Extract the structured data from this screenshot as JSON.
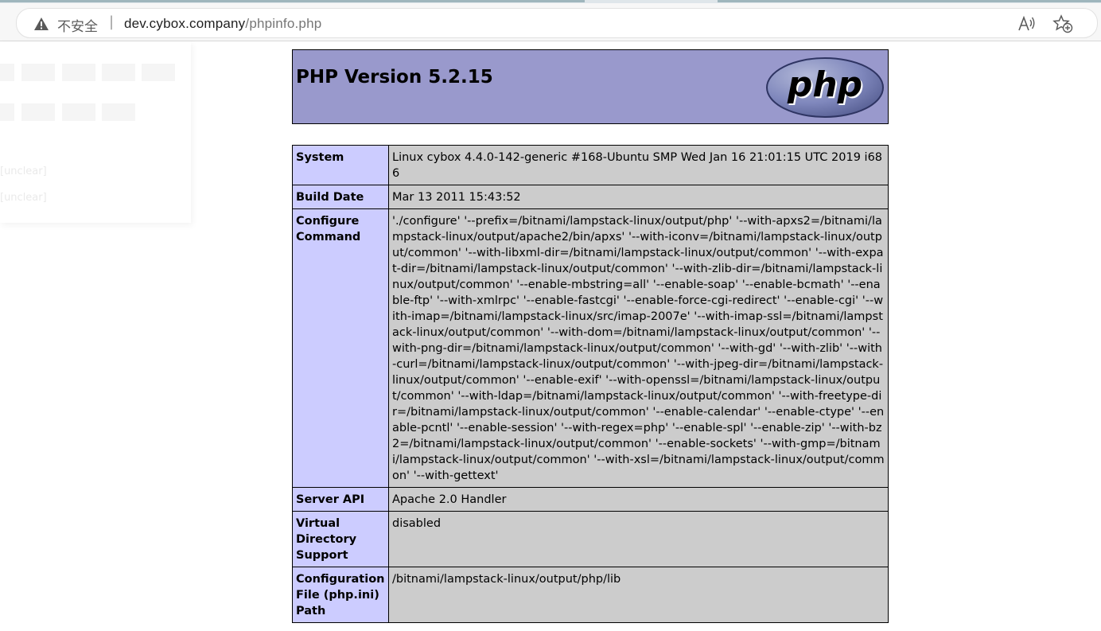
{
  "browser": {
    "security_label": "不安全",
    "url_host": "dev.cybox.company",
    "url_path": "/phpinfo.php",
    "icons": [
      "warning-icon",
      "read-aloud-icon",
      "add-favorite-icon"
    ]
  },
  "ghost_popup": {
    "line1": "[unclear]",
    "line2": "[unclear]"
  },
  "phpinfo": {
    "version_title": "PHP Version 5.2.15",
    "logo_text": "php",
    "colors": {
      "header_bg": "#9999cc",
      "key_bg": "#ccccff",
      "value_bg": "#cccccc"
    },
    "rows": [
      {
        "key": "System",
        "value": "Linux cybox 4.4.0-142-generic #168-Ubuntu SMP Wed Jan 16 21:01:15 UTC 2019 i686"
      },
      {
        "key": "Build Date",
        "value": "Mar 13 2011 15:43:52"
      },
      {
        "key": "Configure Command",
        "value": "'./configure' '--prefix=/bitnami/lampstack-linux/output/php' '--with-apxs2=/bitnami/lampstack-linux/output/apache2/bin/apxs' '--with-iconv=/bitnami/lampstack-linux/output/common' '--with-libxml-dir=/bitnami/lampstack-linux/output/common' '--with-expat-dir=/bitnami/lampstack-linux/output/common' '--with-zlib-dir=/bitnami/lampstack-linux/output/common' '--enable-mbstring=all' '--enable-soap' '--enable-bcmath' '--enable-ftp' '--with-xmlrpc' '--enable-fastcgi' '--enable-force-cgi-redirect' '--enable-cgi' '--with-imap=/bitnami/lampstack-linux/src/imap-2007e' '--with-imap-ssl=/bitnami/lampstack-linux/output/common' '--with-dom=/bitnami/lampstack-linux/output/common' '--with-png-dir=/bitnami/lampstack-linux/output/common' '--with-gd' '--with-zlib' '--with-curl=/bitnami/lampstack-linux/output/common' '--with-jpeg-dir=/bitnami/lampstack-linux/output/common' '--enable-exif' '--with-openssl=/bitnami/lampstack-linux/output/common' '--with-ldap=/bitnami/lampstack-linux/output/common' '--with-freetype-dir=/bitnami/lampstack-linux/output/common' '--enable-calendar' '--enable-ctype' '--enable-pcntl' '--enable-session' '--with-regex=php' '--enable-spl' '--enable-zip' '--with-bz2=/bitnami/lampstack-linux/output/common' '--enable-sockets' '--with-gmp=/bitnami/lampstack-linux/output/common' '--with-xsl=/bitnami/lampstack-linux/output/common' '--with-gettext'"
      },
      {
        "key": "Server API",
        "value": "Apache 2.0 Handler"
      },
      {
        "key": "Virtual Directory Support",
        "value": "disabled"
      },
      {
        "key": "Configuration File (php.ini) Path",
        "value": "/bitnami/lampstack-linux/output/php/lib"
      }
    ]
  }
}
